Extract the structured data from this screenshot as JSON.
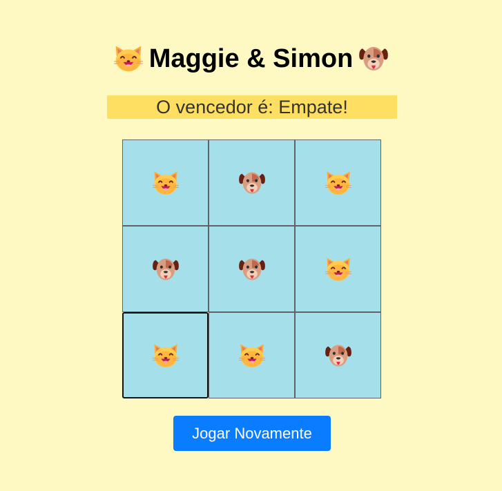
{
  "game": {
    "title": "Maggie & Simon",
    "title_left_icon": "cat-face-icon",
    "title_right_icon": "dog-face-icon",
    "status_text": "O vencedor é: Empate!",
    "board": [
      "cat",
      "dog",
      "cat",
      "dog",
      "dog",
      "cat",
      "cat",
      "cat",
      "dog"
    ],
    "focused_cell": 6,
    "play_again_label": "Jogar Novamente"
  },
  "colors": {
    "background": "#fef9c3",
    "status_bar": "#ffdf62",
    "cell_fill": "#a5e0ea",
    "button": "#0a7cff"
  }
}
